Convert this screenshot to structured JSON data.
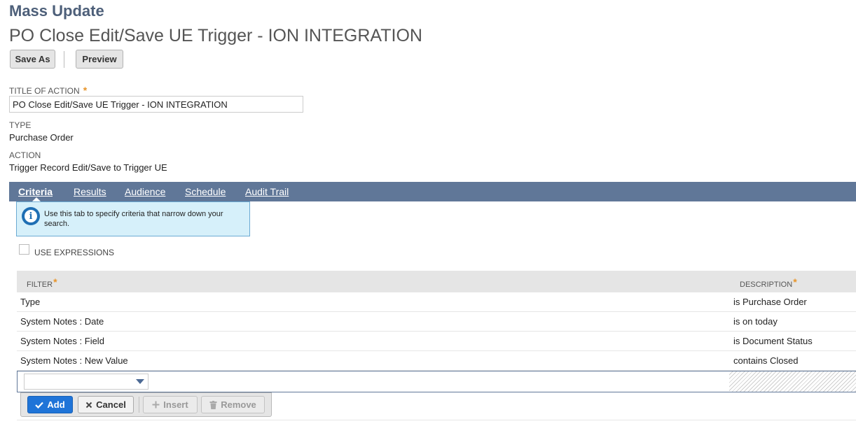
{
  "page": {
    "heading": "Mass Update",
    "record_title": "PO Close Edit/Save UE Trigger - ION INTEGRATION"
  },
  "toolbar": {
    "save_as_label": "Save As",
    "preview_label": "Preview"
  },
  "fields": {
    "title_label": "TITLE OF ACTION",
    "title_required": "*",
    "title_value": "PO Close Edit/Save UE Trigger - ION INTEGRATION",
    "type_label": "TYPE",
    "type_value": "Purchase Order",
    "action_label": "ACTION",
    "action_value": "Trigger Record Edit/Save to Trigger UE"
  },
  "tabs": [
    {
      "label": "Criteria",
      "active": true
    },
    {
      "label": "Results",
      "active": false
    },
    {
      "label": "Audience",
      "active": false
    },
    {
      "label": "Schedule",
      "active": false
    },
    {
      "label": "Audit Trail",
      "active": false
    }
  ],
  "help": {
    "icon": "info-icon",
    "text": "Use this tab to specify criteria that narrow down your search."
  },
  "use_expressions": {
    "label": "USE EXPRESSIONS",
    "checked": false
  },
  "criteria_grid": {
    "columns": [
      {
        "label": "FILTER",
        "required": "*"
      },
      {
        "label": "DESCRIPTION",
        "required": "*"
      }
    ],
    "rows": [
      {
        "filter": "Type",
        "description": "is Purchase Order"
      },
      {
        "filter": "System Notes : Date",
        "description": "is on today"
      },
      {
        "filter": "System Notes : Field",
        "description": "is Document Status"
      },
      {
        "filter": "System Notes : New Value",
        "description": "contains Closed"
      }
    ]
  },
  "row_actions": {
    "add_label": "Add",
    "cancel_label": "Cancel",
    "insert_label": "Insert",
    "remove_label": "Remove"
  },
  "colors": {
    "accent": "#607798",
    "heading": "#4d5f79",
    "required": "#e8952a",
    "primary_button": "#1f74d8",
    "help_bg": "#d6f0fa"
  }
}
